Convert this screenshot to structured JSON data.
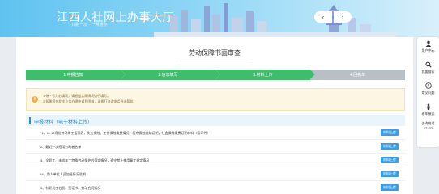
{
  "header": {
    "title": "江西人社网上办事大厅",
    "slogan": "只跑一次 · 一网通办"
  },
  "card": {
    "title": "劳动保障书面审查",
    "steps": [
      {
        "label": "1.申报告知",
        "state": "done"
      },
      {
        "label": "2.信息填写",
        "state": "done"
      },
      {
        "label": "3.材料上传",
        "state": "done"
      },
      {
        "label": "4.回执单",
        "state": "todo"
      }
    ],
    "notice": {
      "lines": [
        "1.带 * 号为必填项，请根据实际情况进行填写。",
        "2.如果您在此次业务办理中遇到困难，请拨打咨询电话寻求帮助。"
      ]
    },
    "section_title": "申报材料（电子材料上传）",
    "files": [
      {
        "label": "*1、11.12月份劳动用工备案表、失业保险、工伤保险缴费情况，医疗保险缴纳证明，社会保险缴费证明材料（复印件）",
        "button": "材料上传"
      },
      {
        "label": "2、最近一次招用劳动者名单",
        "button": "材料上传"
      },
      {
        "label": "3、全职工、未成年工特殊劳动保护的落实情况，遵守禁止使用童工规定情况",
        "button": "材料上传"
      },
      {
        "label": "*4、用人单位人员加班情况说明",
        "button": "材料上传"
      },
      {
        "label": "5、有职员工名册、签证书、劳动合同情况",
        "button": "材料上传"
      }
    ]
  },
  "sidebar": {
    "items": [
      {
        "label": "用户中心",
        "icon": "user-icon"
      },
      {
        "label": "我要搜索",
        "icon": "search-icon"
      },
      {
        "label": "常见问题",
        "icon": "question-icon"
      },
      {
        "label": "老年模式",
        "icon": "elder-icon"
      },
      {
        "label": "咨询电话",
        "icon": "phone-icon"
      }
    ],
    "phone": "12333"
  },
  "colors": {
    "step_done": "#3fbd6d",
    "step_todo": "#b8bfc7",
    "primary": "#3a9ee6",
    "notice_bg": "#fdf6e3"
  }
}
